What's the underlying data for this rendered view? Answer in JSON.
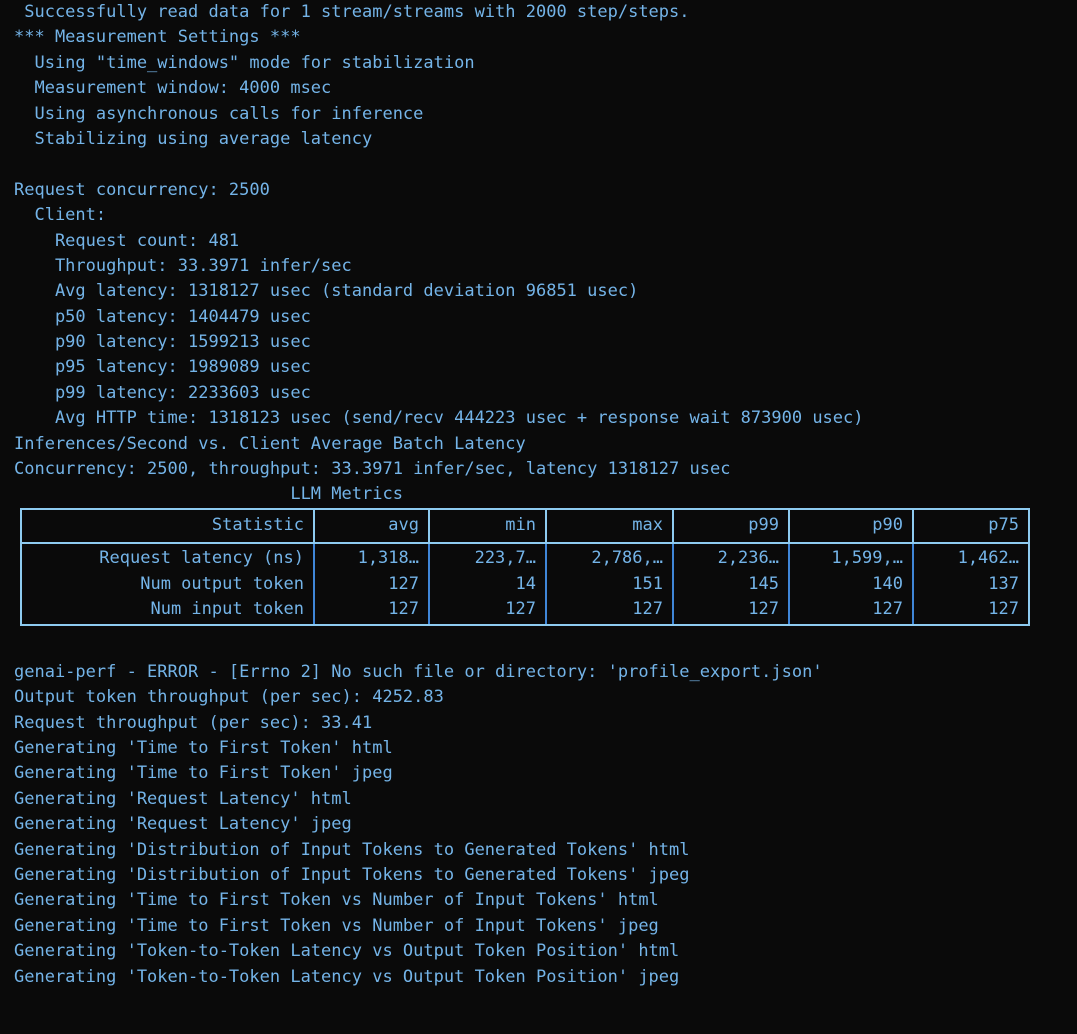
{
  "terminal": {
    "background_color": "#0a0a0a",
    "text_color": "#74b4e8",
    "table_border_color": "#8ecbf0",
    "table_inner_border_color": "#3f86d8"
  },
  "log": {
    "pre_table_lines": [
      " Successfully read data for 1 stream/streams with 2000 step/steps.",
      "*** Measurement Settings ***",
      "  Using \"time_windows\" mode for stabilization",
      "  Measurement window: 4000 msec",
      "  Using asynchronous calls for inference",
      "  Stabilizing using average latency",
      "",
      "Request concurrency: 2500",
      "  Client:",
      "    Request count: 481",
      "    Throughput: 33.3971 infer/sec",
      "    Avg latency: 1318127 usec (standard deviation 96851 usec)",
      "    p50 latency: 1404479 usec",
      "    p90 latency: 1599213 usec",
      "    p95 latency: 1989089 usec",
      "    p99 latency: 2233603 usec",
      "    Avg HTTP time: 1318123 usec (send/recv 444223 usec + response wait 873900 usec)",
      "Inferences/Second vs. Client Average Batch Latency",
      "Concurrency: 2500, throughput: 33.3971 infer/sec, latency 1318127 usec",
      "                           LLM Metrics"
    ],
    "post_table_lines": [
      "genai-perf - ERROR - [Errno 2] No such file or directory: 'profile_export.json'",
      "Output token throughput (per sec): 4252.83",
      "Request throughput (per sec): 33.41",
      "Generating 'Time to First Token' html",
      "Generating 'Time to First Token' jpeg",
      "Generating 'Request Latency' html",
      "Generating 'Request Latency' jpeg",
      "Generating 'Distribution of Input Tokens to Generated Tokens' html",
      "Generating 'Distribution of Input Tokens to Generated Tokens' jpeg",
      "Generating 'Time to First Token vs Number of Input Tokens' html",
      "Generating 'Time to First Token vs Number of Input Tokens' jpeg",
      "Generating 'Token-to-Token Latency vs Output Token Position' html",
      "Generating 'Token-to-Token Latency vs Output Token Position' jpeg"
    ]
  },
  "llm_metrics_table": {
    "title": "LLM Metrics",
    "headers": [
      "Statistic",
      "avg",
      "min",
      "max",
      "p99",
      "p90",
      "p75"
    ],
    "rows": [
      {
        "label": "Request latency (ns)",
        "avg": "1,318…",
        "min": "223,7…",
        "max": "2,786,…",
        "p99": "2,236…",
        "p90": "1,599,…",
        "p75": "1,462…"
      },
      {
        "label": "Num output token",
        "avg": "127",
        "min": "14",
        "max": "151",
        "p99": "145",
        "p90": "140",
        "p75": "137"
      },
      {
        "label": "Num input token",
        "avg": "127",
        "min": "127",
        "max": "127",
        "p99": "127",
        "p90": "127",
        "p75": "127"
      }
    ]
  }
}
